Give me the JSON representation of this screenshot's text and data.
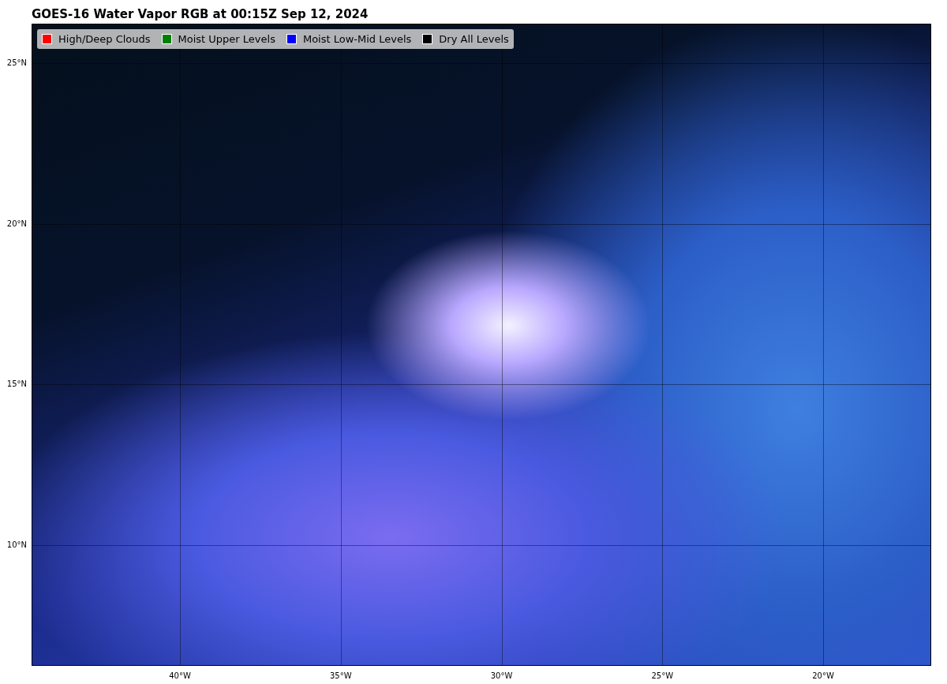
{
  "title": "GOES-16 Water Vapor RGB at 00:15Z Sep 12, 2024",
  "legend": [
    {
      "label": "High/Deep Clouds",
      "color": "#ff0000"
    },
    {
      "label": "Moist Upper Levels",
      "color": "#008000"
    },
    {
      "label": "Moist Low-Mid Levels",
      "color": "#0000ff"
    },
    {
      "label": "Dry All Levels",
      "color": "#000000"
    }
  ],
  "y_axis_labels": [
    "25°N",
    "20°N",
    "15°N",
    "10°N"
  ],
  "x_axis_labels": [
    "40°W",
    "35°W",
    "30°W",
    "25°W",
    "20°W"
  ]
}
